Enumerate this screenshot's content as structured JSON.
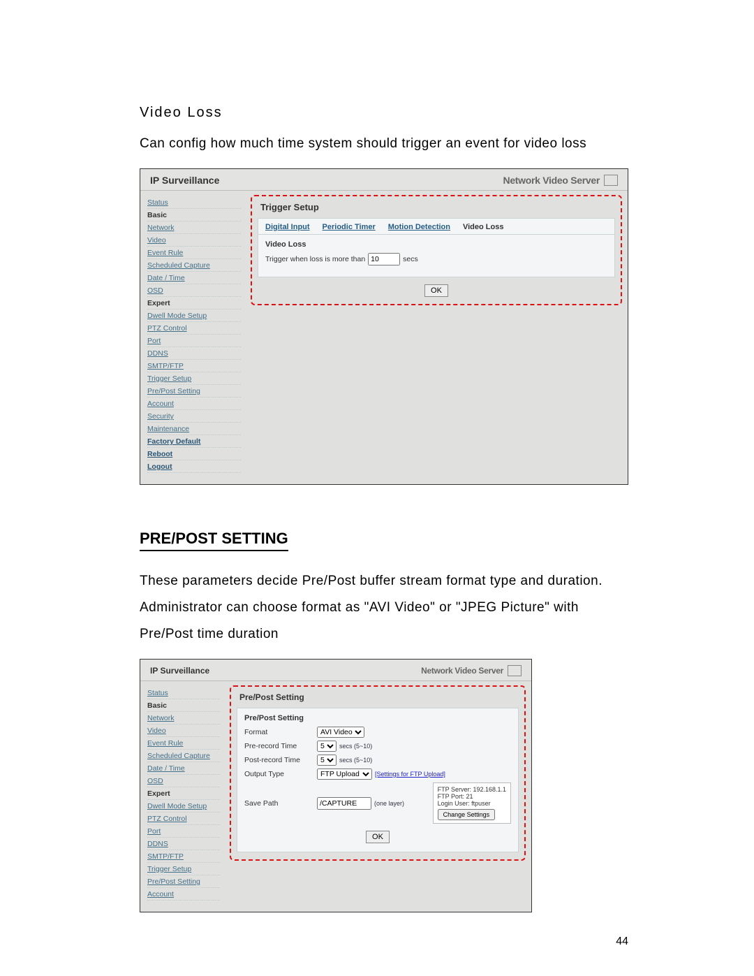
{
  "page_number": "44",
  "section1": {
    "label": "Video Loss",
    "text": "Can config how much time system should trigger an event for video loss"
  },
  "section2": {
    "heading": "PRE/POST SETTING",
    "text": "These parameters decide Pre/Post buffer stream format type and duration. Administrator can choose format as \"AVI Video\" or \"JPEG Picture\" with Pre/Post time duration"
  },
  "scr1": {
    "app_title": "IP Surveillance",
    "brand": "Network Video Server",
    "sidebar": {
      "status": "Status",
      "basic": "Basic",
      "items_basic": [
        "Network",
        "Video",
        "Event Rule",
        "Scheduled Capture",
        "Date / Time",
        "OSD"
      ],
      "expert": "Expert",
      "items_expert": [
        "Dwell Mode Setup",
        "PTZ Control",
        "Port",
        "DDNS",
        "SMTP/FTP",
        "Trigger Setup",
        "Pre/Post Setting",
        "Account",
        "Security",
        "Maintenance"
      ],
      "factory_default": "Factory Default",
      "reboot": "Reboot",
      "logout": "Logout"
    },
    "panel": {
      "title": "Trigger Setup",
      "tabs": [
        "Digital Input",
        "Periodic Timer",
        "Motion Detection",
        "Video Loss"
      ],
      "active_tab_index": 3,
      "subheading": "Video Loss",
      "trigger_label_pre": "Trigger when loss is more than",
      "trigger_value": "10",
      "trigger_label_post": "secs",
      "ok_label": "OK"
    }
  },
  "scr2": {
    "app_title": "IP Surveillance",
    "brand": "Network Video Server",
    "sidebar": {
      "status": "Status",
      "basic": "Basic",
      "items_basic": [
        "Network",
        "Video",
        "Event Rule",
        "Scheduled Capture",
        "Date / Time",
        "OSD"
      ],
      "expert": "Expert",
      "items_expert": [
        "Dwell Mode Setup",
        "PTZ Control",
        "Port",
        "DDNS",
        "SMTP/FTP",
        "Trigger Setup",
        "Pre/Post Setting",
        "Account"
      ]
    },
    "panel": {
      "title": "Pre/Post Setting",
      "subheading": "Pre/Post Setting",
      "rows": {
        "format_label": "Format",
        "format_value": "AVI Video",
        "pre_label": "Pre-record Time",
        "pre_value": "5",
        "pre_hint": "secs (5~10)",
        "post_label": "Post-record Time",
        "post_value": "5",
        "post_hint": "secs (5~10)",
        "output_label": "Output Type",
        "output_value": "FTP Upload",
        "output_hint": "[Settings for FTP Upload]",
        "save_label": "Save Path",
        "save_value": "/CAPTURE",
        "save_hint": "(one layer)"
      },
      "popup": {
        "line1": "FTP Server: 192.168.1.1",
        "line2": "FTP Port: 21",
        "line3": "Login User: ftpuser",
        "button": "Change Settings"
      },
      "ok_label": "OK"
    }
  }
}
